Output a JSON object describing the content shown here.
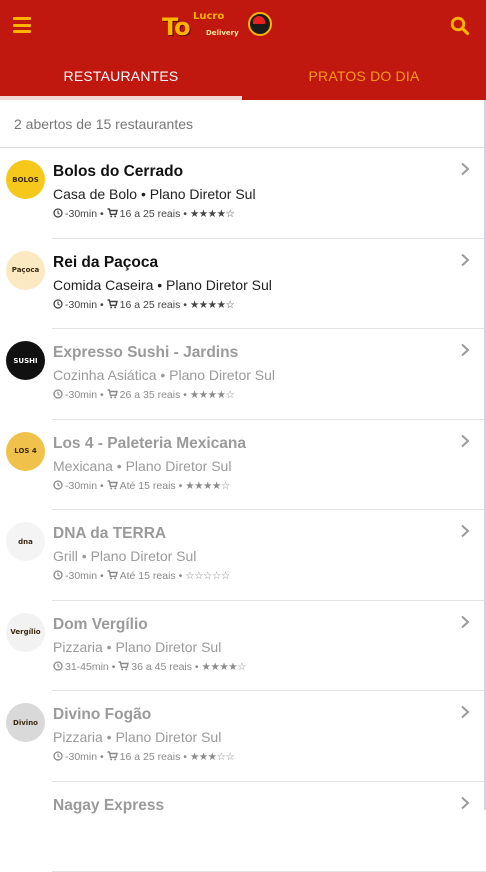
{
  "header": {
    "logo": {
      "main": "To",
      "small": "Lucro",
      "sub": "Delivery"
    },
    "tabs": [
      {
        "label": "RESTAURANTES",
        "active": true
      },
      {
        "label": "PRATOS DO DIA",
        "active": false
      }
    ],
    "colors": {
      "bar": "#c0170f",
      "accent": "#ffb400",
      "inactive_tab": "#ff9a1a"
    }
  },
  "summary": "2 abertos de 15 restaurantes",
  "restaurants": [
    {
      "name": "Bolos do Cerrado",
      "category": "Casa de Bolo • Plano Diretor Sul",
      "time": "-30min",
      "price": "16 a 25 reais",
      "stars": "★★★★☆",
      "open": true,
      "logo_text": "BOLOS",
      "logo_bg": "#f7c81c"
    },
    {
      "name": "Rei da Paçoca",
      "category": "Comida Caseira • Plano Diretor Sul",
      "time": "-30min",
      "price": "16 a 25 reais",
      "stars": "★★★★☆",
      "open": true,
      "logo_text": "Paçoca",
      "logo_bg": "#fbe9c2"
    },
    {
      "name": "Expresso Sushi - Jardins",
      "category": "Cozinha Asiática • Plano Diretor Sul",
      "time": "-30min",
      "price": "26 a 35 reais",
      "stars": "★★★★☆",
      "open": false,
      "logo_text": "SUSHI",
      "logo_bg": "#111111"
    },
    {
      "name": "Los 4 - Paleteria Mexicana",
      "category": "Mexicana • Plano Diretor Sul",
      "time": "-30min",
      "price": "Até 15 reais",
      "stars": "★★★★☆",
      "open": false,
      "logo_text": "LOS 4",
      "logo_bg": "#f0c24b"
    },
    {
      "name": "DNA da TERRA",
      "category": "Grill • Plano Diretor Sul",
      "time": "-30min",
      "price": "Até 15 reais",
      "stars": "☆☆☆☆☆",
      "open": false,
      "logo_text": "dna",
      "logo_bg": "#f4f4f4"
    },
    {
      "name": "Dom Vergílio",
      "category": "Pizzaria • Plano Diretor Sul",
      "time": "31-45min",
      "price": "36 a 45 reais",
      "stars": "★★★★☆",
      "open": false,
      "logo_text": "Vergílio",
      "logo_bg": "#f2f2f2"
    },
    {
      "name": "Divino Fogão",
      "category": "Pizzaria • Plano Diretor Sul",
      "time": "-30min",
      "price": "16 a 25 reais",
      "stars": "★★★☆☆",
      "open": false,
      "logo_text": "Divino",
      "logo_bg": "#d9d9d9"
    },
    {
      "name": "Nagay Express",
      "category": "",
      "time": "",
      "price": "",
      "stars": "",
      "open": false,
      "logo_text": "",
      "logo_bg": "#ffffff"
    }
  ]
}
